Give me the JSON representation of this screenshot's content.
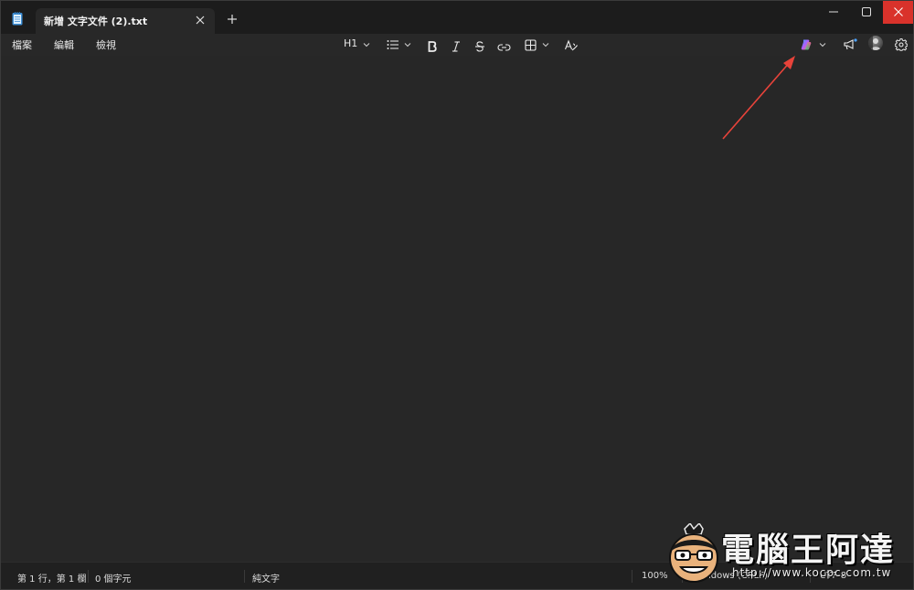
{
  "titlebar": {
    "tab_title": "新增 文字文件 (2).txt",
    "icons": [
      "notepad-icon",
      "close-icon",
      "plus-icon",
      "minimize-icon",
      "maximize-icon",
      "window-close-icon"
    ]
  },
  "menu": {
    "file": "檔案",
    "edit": "編輯",
    "view": "檢視"
  },
  "toolbar": {
    "heading": "H1",
    "icons": [
      "list-icon",
      "bold-icon",
      "italic-icon",
      "strikethrough-icon",
      "link-icon",
      "table-icon",
      "clear-format-icon",
      "copilot-icon",
      "megaphone-icon",
      "avatar",
      "gear-icon"
    ]
  },
  "status": {
    "position": "第 1 行，第 1 欄",
    "chars": "0 個字元",
    "format": "純文字",
    "zoom": "100%",
    "line_ending": "Windows (CRLF)",
    "encoding": "UTF-8"
  },
  "watermark": {
    "title": "電腦王阿達",
    "url": "http://www.kocpc.com.tw"
  },
  "colors": {
    "titlebar": "#1c1c1c",
    "toolbar": "#282828",
    "editor": "#272727",
    "close": "#d9322b",
    "arrow": "#e8433a"
  }
}
